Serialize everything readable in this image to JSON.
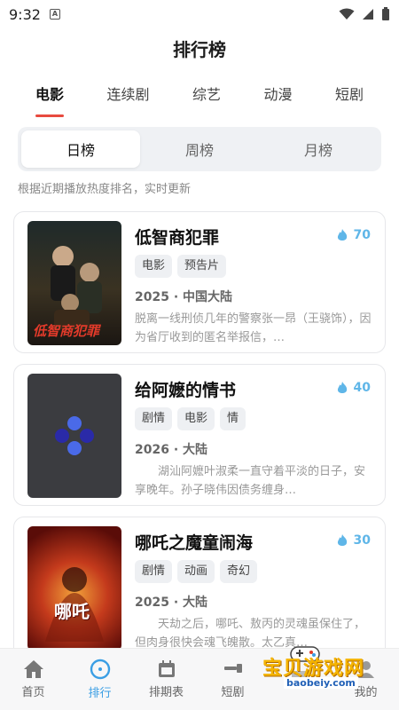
{
  "status": {
    "time": "9:32",
    "notif_glyph": "A"
  },
  "app": {
    "title": "排行榜"
  },
  "category_tabs": [
    {
      "label": "电影",
      "active": true
    },
    {
      "label": "连续剧",
      "active": false
    },
    {
      "label": "综艺",
      "active": false
    },
    {
      "label": "动漫",
      "active": false
    },
    {
      "label": "短剧",
      "active": false
    }
  ],
  "period_tabs": [
    {
      "label": "日榜",
      "active": true
    },
    {
      "label": "周榜",
      "active": false
    },
    {
      "label": "月榜",
      "active": false
    }
  ],
  "hint": "根据近期播放热度排名，实时更新",
  "items": [
    {
      "title": "低智商犯罪",
      "heat": "70",
      "tags": [
        "电影",
        "预告片"
      ],
      "meta": "2025 · 中国大陆",
      "desc": "脱离一线刑侦几年的警察张一昂（王骁饰），因为省厅收到的匿名举报信，…",
      "poster_text": "低智商犯罪"
    },
    {
      "title": "给阿嬷的情书",
      "heat": "40",
      "tags": [
        "剧情",
        "电影",
        "情"
      ],
      "meta": "2026 · 大陆",
      "desc": "　　湖汕阿嬷叶淑柔一直守着平淡的日子，安享晚年。孙子晓伟因债务缠身…",
      "poster_text": ""
    },
    {
      "title": "哪吒之魔童闹海",
      "heat": "30",
      "tags": [
        "剧情",
        "动画",
        "奇幻"
      ],
      "meta": "2025 · 大陆",
      "desc": "　　天劫之后，哪吒、敖丙的灵魂虽保住了，但肉身很快会魂飞魄散。太乙真…",
      "poster_text": "哪吒"
    }
  ],
  "bottom_nav": [
    {
      "label": "首页",
      "icon": "home-icon",
      "active": false
    },
    {
      "label": "排行",
      "icon": "ranking-icon",
      "active": true
    },
    {
      "label": "排期表",
      "icon": "calendar-icon",
      "active": false
    },
    {
      "label": "短剧",
      "icon": "short-drama-icon",
      "active": false
    },
    {
      "label": "",
      "icon": "discover-icon",
      "active": false
    },
    {
      "label": "我的",
      "icon": "profile-icon",
      "active": false
    }
  ],
  "watermark": {
    "text": "宝贝游戏网",
    "url": "baobeiy.com"
  },
  "colors": {
    "accent_red": "#e84a3f",
    "accent_blue": "#3a9ee4",
    "heat_blue": "#5fb6e8"
  }
}
